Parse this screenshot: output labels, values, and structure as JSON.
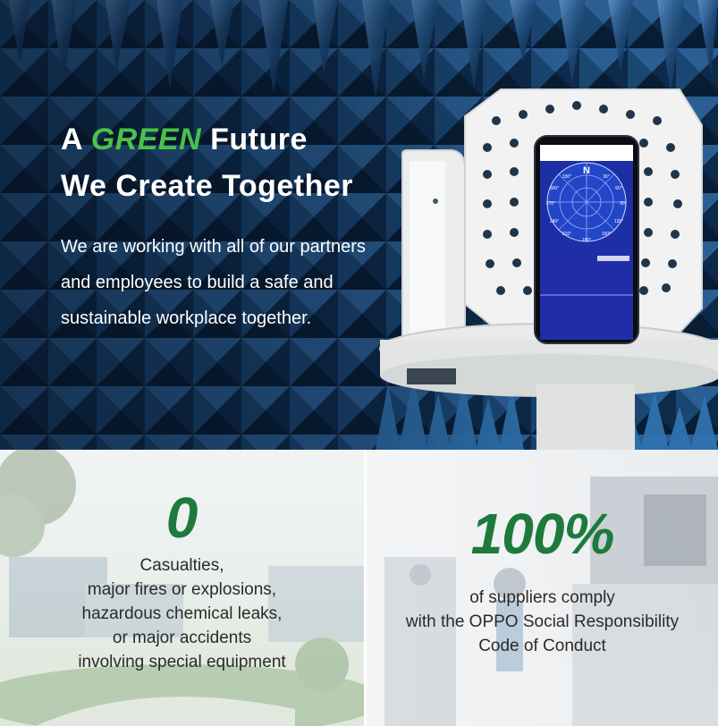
{
  "hero": {
    "title_prefix": "A",
    "title_highlight": "GREEN",
    "title_suffix": "Future",
    "title_line2": "We Create Together",
    "body": "We are working with all of our partners and employees to build a safe and sustainable workplace together.",
    "highlight_color": "#48c24a"
  },
  "phone": {
    "compass_heading": "N",
    "compass_labels": [
      "330°",
      "30°",
      "300°",
      "60°",
      "270°",
      "90°",
      "240°",
      "120°",
      "210°",
      "150°",
      "180°"
    ]
  },
  "stats": {
    "left": {
      "value": "0",
      "lines": [
        "Casualties,",
        "major fires or explosions,",
        "hazardous chemical leaks,",
        "or major accidents",
        "involving special equipment"
      ]
    },
    "right": {
      "value": "100%",
      "lines": [
        "of suppliers comply",
        "with the OPPO Social Responsibility",
        "Code of Conduct"
      ]
    },
    "accent_color": "#1d7a3c"
  }
}
